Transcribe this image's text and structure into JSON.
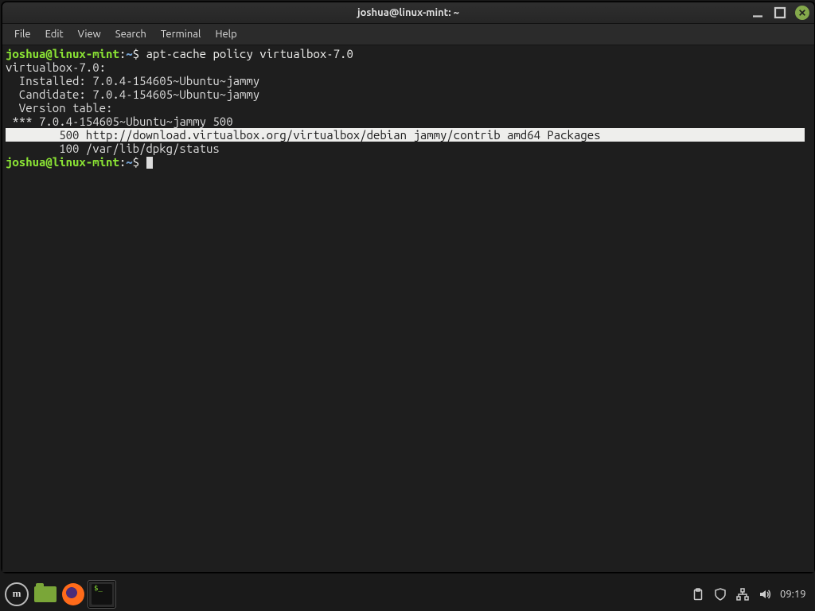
{
  "titlebar": {
    "title": "joshua@linux-mint: ~"
  },
  "menubar": {
    "items": [
      "File",
      "Edit",
      "View",
      "Search",
      "Terminal",
      "Help"
    ]
  },
  "prompt": {
    "user_host": "joshua@linux-mint",
    "sep": ":",
    "path": "~",
    "sigil": "$"
  },
  "terminal": {
    "cmd1": "apt-cache policy virtualbox-7.0",
    "out_pkg": "virtualbox-7.0:",
    "out_installed": "  Installed: 7.0.4-154605~Ubuntu~jammy",
    "out_candidate": "  Candidate: 7.0.4-154605~Ubuntu~jammy",
    "out_vtable": "  Version table:",
    "out_vline": " *** 7.0.4-154605~Ubuntu~jammy 500",
    "out_src_hl": "        500 http://download.virtualbox.org/virtualbox/debian jammy/contrib amd64 Packages",
    "out_status": "        100 /var/lib/dpkg/status"
  },
  "panel": {
    "mint_glyph": "m",
    "term_prompt_glyph": "$_",
    "clock": "09:19"
  }
}
